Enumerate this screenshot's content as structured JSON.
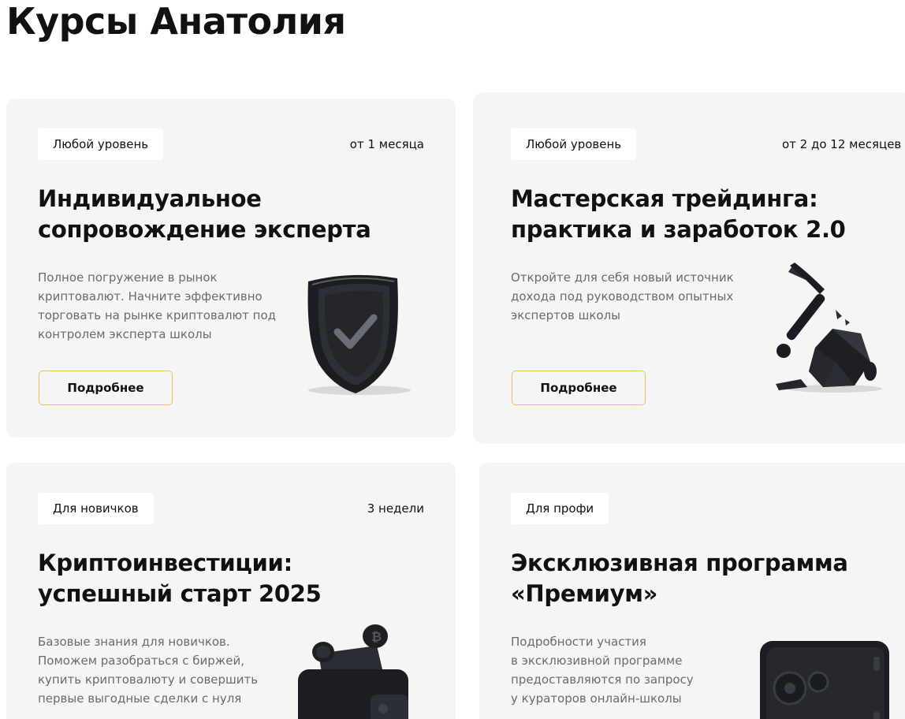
{
  "page": {
    "title": "Курсы Анатолия"
  },
  "cards": [
    {
      "level": "Любой уровень",
      "duration": "от 1 месяца",
      "title": "Индивидуальное\nсопровождение эксперта",
      "description": "Полное погружение в рынок\nкриптовалют. Начните эффективно\nторговать на рынке криптовалют под\nконтролем эксперта школы",
      "button_label": "Подробнее",
      "illustration": "shield-check-icon"
    },
    {
      "level": "Любой уровень",
      "duration": "от 2 до 12 месяцев",
      "title": "Мастерская трейдинга:\nпрактика и заработок 2.0",
      "description": "Откройте для себя новый источник\nдохода под руководством опытных\nэкспертов школы",
      "button_label": "Подробнее",
      "illustration": "pickaxe-icon"
    },
    {
      "level": "Для новичков",
      "duration": "3 недели",
      "title": "Криптоинвестиции:\nуспешный старт 2025",
      "description": "Базовые знания для новичков.\nПоможем разобраться с биржей,\nкупить криптовалюту и совершить\nпервые выгодные сделки с нуля",
      "illustration": "wallet-coins-icon"
    },
    {
      "level": "Для профи",
      "title": "Эксклюзивная программа\n«Премиум»",
      "description": "Подробности участия\nв эксклюзивной программе\nпредоставляются по запросу\nу кураторов онлайн-школы",
      "illustration": "safe-icon"
    }
  ],
  "colors": {
    "card_background": "#f5f5f5",
    "button_border": "#e8c25e",
    "description_text": "#6b6b6b"
  }
}
